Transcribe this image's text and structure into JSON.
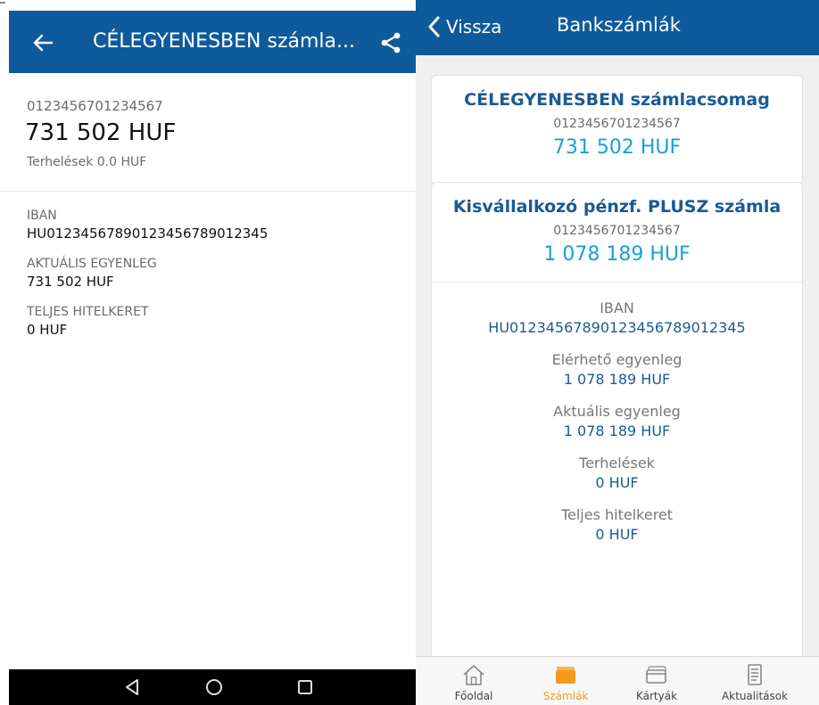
{
  "android": {
    "header": {
      "title": "CÉLEGYENESBEN számla..."
    },
    "summary": {
      "account_number": "0123456701234567",
      "balance": "731 502 HUF",
      "charges": "Terhelések 0.0 HUF"
    },
    "details": [
      {
        "label": "IBAN",
        "value": "HU0123456789012345678901234​5"
      },
      {
        "label": "AKTUÁLIS EGYENLEG",
        "value": "731 502 HUF"
      },
      {
        "label": "TELJES HITELKERET",
        "value": "0 HUF"
      }
    ]
  },
  "ios": {
    "nav": {
      "back_label": "Vissza",
      "title": "Bankszámlák"
    },
    "accounts": [
      {
        "name": "CÉLEGYENESBEN számlacsomag",
        "number": "0123456701234567",
        "balance": "731 502 HUF"
      },
      {
        "name": "Kisvállalkozó pénzf. PLUSZ számla",
        "number": "0123456701234567",
        "balance": "1 078 189 HUF"
      }
    ],
    "details": [
      {
        "label": "IBAN",
        "value": "HU0123456789012345678901234​5"
      },
      {
        "label": "Elérhető egyenleg",
        "value": "1 078 189 HUF"
      },
      {
        "label": "Aktuális egyenleg",
        "value": "1 078 189 HUF"
      },
      {
        "label": "Terhelések",
        "value": "0 HUF"
      },
      {
        "label": "Teljes hitelkeret",
        "value": "0 HUF"
      }
    ],
    "tabs": [
      {
        "label": "Főoldal",
        "icon": "home-icon"
      },
      {
        "label": "Számlák",
        "icon": "wallet-icon",
        "active": true
      },
      {
        "label": "Kártyák",
        "icon": "card-icon"
      },
      {
        "label": "Aktualitások",
        "icon": "news-icon"
      }
    ]
  },
  "colors": {
    "header_blue": "#0f5a9c",
    "link_blue": "#1a5a95",
    "balance_blue": "#1a9fd8",
    "active_orange": "#f39a1d"
  }
}
